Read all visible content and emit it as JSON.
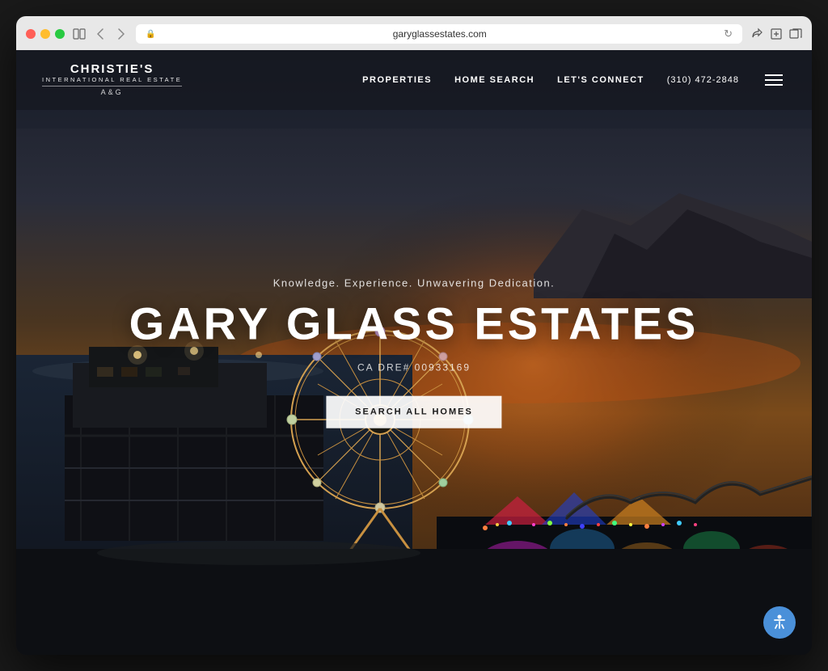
{
  "browser": {
    "url": "garyglassestates.com",
    "traffic_lights": [
      "red",
      "yellow",
      "green"
    ]
  },
  "navbar": {
    "logo": {
      "line1": "CHRISTIE'S",
      "line2": "INTERNATIONAL REAL ESTATE",
      "line3": "A&G"
    },
    "nav_items": [
      {
        "label": "PROPERTIES",
        "id": "properties"
      },
      {
        "label": "HOME SEARCH",
        "id": "home-search"
      },
      {
        "label": "LET'S CONNECT",
        "id": "lets-connect"
      }
    ],
    "phone": "(310) 472-2848",
    "hamburger_label": "menu"
  },
  "hero": {
    "subtitle": "Knowledge. Experience. Unwavering Dedication.",
    "title": "GARY GLASS ESTATES",
    "dre": "CA DRE# 00933169",
    "cta_button": "SEARCH ALL HOMES"
  },
  "accessibility": {
    "button_label": "Accessibility"
  }
}
